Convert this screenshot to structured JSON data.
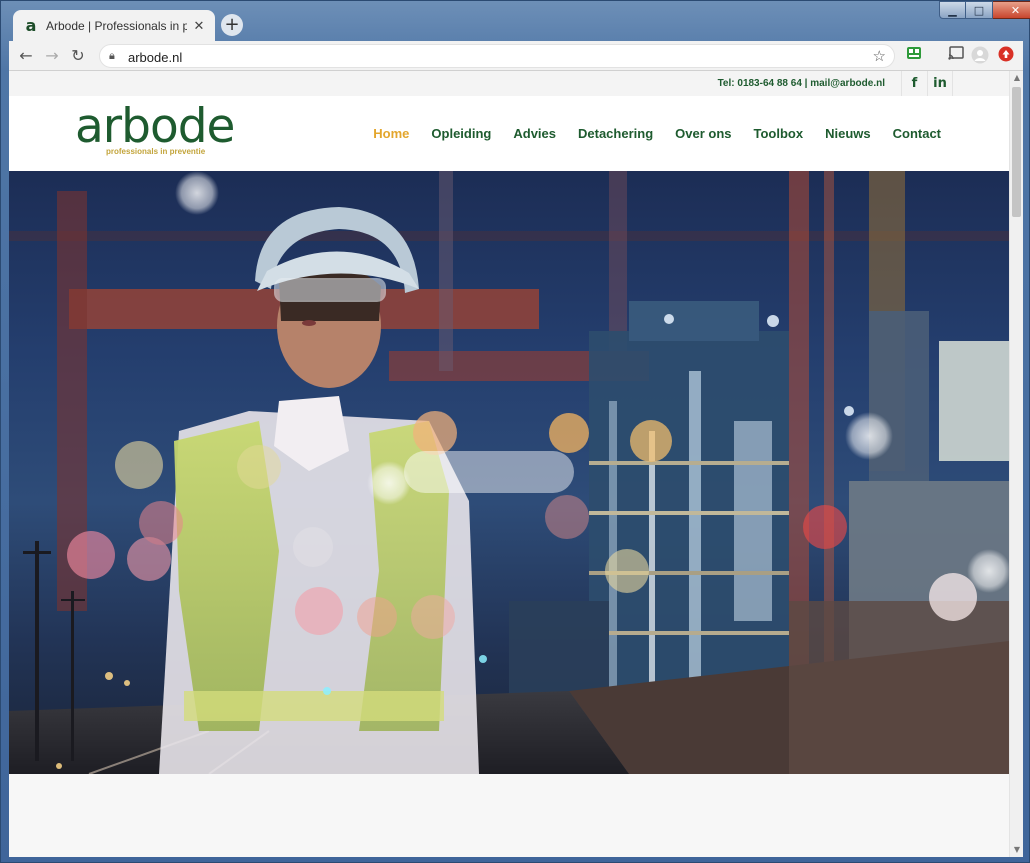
{
  "browser": {
    "tab_title": "Arbode | Professionals in preventie",
    "favicon_letter": "a",
    "url": "arbode.nl",
    "colors": {
      "frame": "#4f76a6",
      "toolbar": "#f2f2f2"
    }
  },
  "site": {
    "contact_line": "Tel: 0183-64 88 64 | mail@arbode.nl",
    "social": {
      "facebook_glyph": "f",
      "linkedin_glyph": "in"
    },
    "logo": {
      "word": "arbode",
      "tagline": "professionals in preventie"
    },
    "nav": [
      {
        "label": "Home",
        "active": true
      },
      {
        "label": "Opleiding"
      },
      {
        "label": "Advies"
      },
      {
        "label": "Detachering"
      },
      {
        "label": "Over ons"
      },
      {
        "label": "Toolbox"
      },
      {
        "label": "Nieuws"
      },
      {
        "label": "Contact"
      }
    ],
    "colors": {
      "brand_green": "#1e5b2f",
      "accent_gold": "#e3a62d",
      "tagline_gold": "#c3a53c"
    }
  }
}
